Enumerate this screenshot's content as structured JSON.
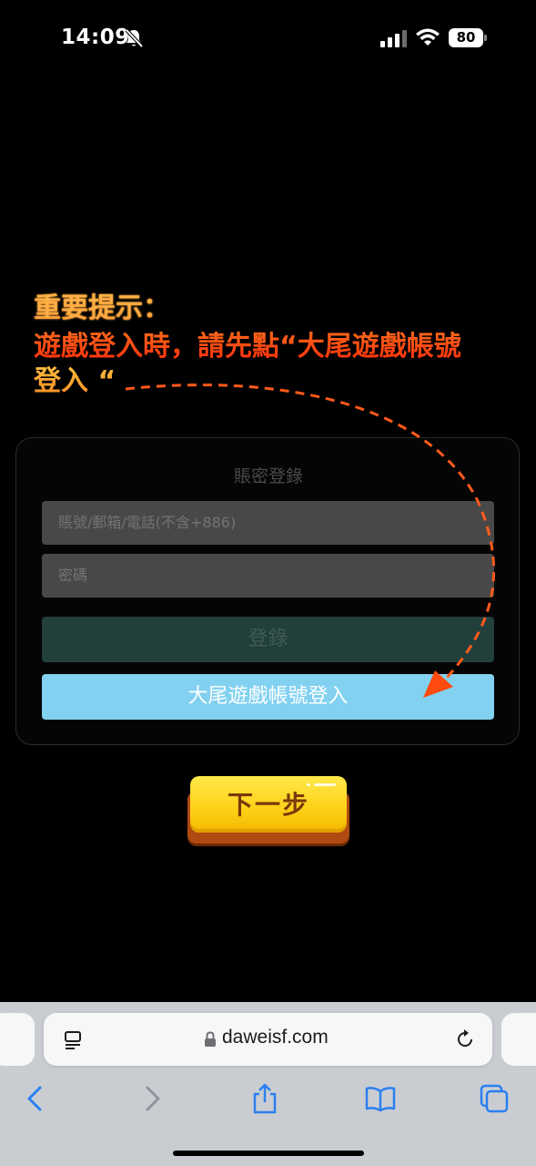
{
  "status_bar": {
    "time": "14:09",
    "battery": "80",
    "icons": [
      "bell-slash-icon",
      "cellular-signal-icon",
      "wifi-icon",
      "battery-icon"
    ]
  },
  "tip": {
    "title": "重要提示：",
    "line1": "遊戲登入時，請先點“大尾遊戲帳號",
    "line2": "登入 “"
  },
  "login": {
    "title": "賬密登錄",
    "account_placeholder": "賬號/郵箱/電話(不含+886)",
    "password_placeholder": "密碼",
    "login_label": "登錄",
    "dawei_label": "大尾遊戲帳號登入"
  },
  "next_button": {
    "label": "下一步"
  },
  "safari": {
    "url": "daweisf.com",
    "icons": [
      "reader-icon",
      "lock-icon",
      "reload-icon",
      "back-icon",
      "forward-icon",
      "share-icon",
      "bookmarks-icon",
      "tabs-icon"
    ]
  },
  "colors": {
    "tip_orange": "#ff8a1a",
    "tip_red": "#ff3a10",
    "dawei_button": "#82d1f1",
    "login_button": "#223f3b",
    "next_button": "#ffd21a",
    "safari_blue": "#2a7ff0"
  }
}
